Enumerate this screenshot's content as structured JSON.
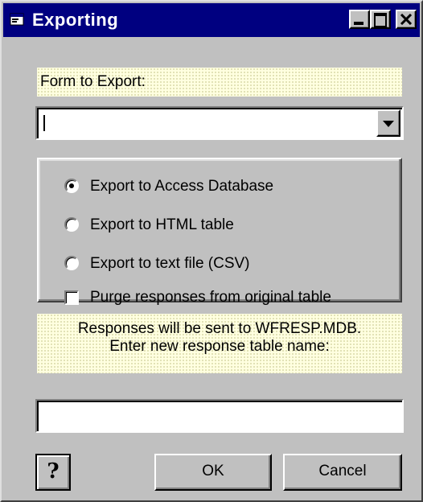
{
  "window": {
    "title": "Exporting",
    "icon": "app-window-icon",
    "controls": [
      "minimize-icon",
      "maximize-icon",
      "close-icon"
    ]
  },
  "form_label": "Form to Export:",
  "form_select": {
    "value": ""
  },
  "export_options": [
    {
      "label": "Export to Access Database",
      "type": "radio",
      "checked": true
    },
    {
      "label": "Export to HTML table",
      "type": "radio",
      "checked": false
    },
    {
      "label": "Export to text file (CSV)",
      "type": "radio",
      "checked": false
    },
    {
      "label": "Purge responses from original table",
      "type": "checkbox",
      "checked": false
    }
  ],
  "info": {
    "line1": "Responses will be sent to WFRESP.MDB.",
    "line2": "Enter new response table name:"
  },
  "table_name_input": {
    "value": ""
  },
  "buttons": {
    "help": "?",
    "ok": "OK",
    "cancel": "Cancel"
  },
  "colors": {
    "titlebar": "#000080",
    "face": "#c0c0c0",
    "label_background": "#ffffe0"
  }
}
